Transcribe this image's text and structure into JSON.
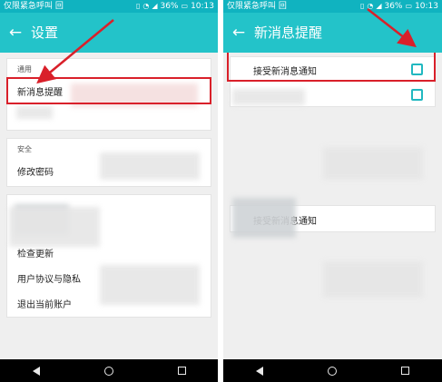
{
  "left": {
    "status": {
      "carrier": "仅限紧急呼叫 回",
      "battery": "36%",
      "time": "10:13"
    },
    "appbar": {
      "title": "设置"
    },
    "sections": [
      {
        "label": "通用",
        "rows": [
          "新消息提醒"
        ]
      },
      {
        "label": "安全",
        "rows": [
          "修改密码"
        ]
      },
      {
        "label": "",
        "rows": [
          "检查更新",
          "用户协议与隐私",
          "退出当前账户"
        ]
      }
    ]
  },
  "right": {
    "status": {
      "carrier": "仅限紧急呼叫 回",
      "battery": "36%",
      "time": "10:13"
    },
    "appbar": {
      "title": "新消息提醒"
    },
    "rows": [
      {
        "label": "接受新消息通知",
        "checked": false
      },
      {
        "label": "",
        "checked": false
      }
    ],
    "extra_label": "接受新消息通知"
  },
  "icons": {
    "back": "arrow-left",
    "nav": [
      "triangle-back",
      "circle-home",
      "square-recent"
    ]
  },
  "colors": {
    "statusbar": "#10b3c0",
    "appbar": "#23c3c9",
    "highlight": "#d9202a",
    "checkbox": "#21b8c0"
  }
}
